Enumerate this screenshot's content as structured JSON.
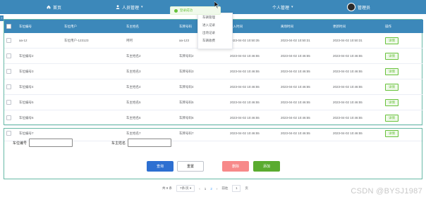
{
  "nav": {
    "home": "首页",
    "person_mgmt": "人员管理",
    "personal_mgmt": "个人管理",
    "username": "管理员",
    "menu_items": [
      "车辆管理",
      "进入记录",
      "出场记录",
      "车辆收费"
    ]
  },
  "toast": {
    "text": "登录成功"
  },
  "table": {
    "columns": [
      "车位编号",
      "车位用户",
      "车主姓名",
      "车牌号码",
      "进入时间",
      "离场时间",
      "更新时间",
      "操作"
    ],
    "rows": [
      [
        "aa-12",
        "车位用户-123123",
        "呵呵",
        "aa-123",
        "2023-04-02 10:50:35",
        "2023-04-02 10:50:31",
        "2023-04-02 10:50:31",
        "详情"
      ],
      [
        "车位编号2",
        "",
        "车主姓名2",
        "车牌号码2",
        "2023-04-02 10:46:55",
        "2023-04-02 10:46:55",
        "2023-04-02 10:46:55",
        "详情"
      ],
      [
        "车位编号3",
        "",
        "车主姓名3",
        "车牌号码3",
        "2023-04-02 10:46:55",
        "2023-04-02 10:46:55",
        "2023-04-02 10:46:55",
        "详情"
      ],
      [
        "车位编号4",
        "",
        "车主姓名4",
        "车牌号码4",
        "2023-04-02 10:46:55",
        "2023-04-02 10:46:55",
        "2023-04-02 10:46:55",
        "详情"
      ],
      [
        "车位编号5",
        "",
        "车主姓名5",
        "车牌号码5",
        "2023-04-02 10:46:55",
        "2023-04-02 10:46:55",
        "2023-04-02 10:46:55",
        "详情"
      ],
      [
        "车位编号6",
        "",
        "车主姓名6",
        "车牌号码6",
        "2023-04-02 10:46:55",
        "2023-04-02 10:46:55",
        "2023-04-02 10:46:55",
        "详情"
      ],
      [
        "车位编号7",
        "",
        "车主姓名7",
        "车牌号码7",
        "2023-04-02 10:46:55",
        "2023-04-02 10:46:55",
        "2023-04-02 10:46:55",
        "详情"
      ]
    ]
  },
  "search": {
    "label_spot": "车位编号",
    "label_owner": "车主姓名",
    "btn_query": "查询",
    "btn_reset": "重置",
    "btn_delete": "删除",
    "btn_add": "添加"
  },
  "pager": {
    "total": "共 9 条",
    "page_size": "7条/页",
    "pages": [
      "1",
      "2"
    ],
    "current": "2",
    "goto_label": "前往",
    "goto_value": "1",
    "page_unit": "页"
  },
  "watermark": "CSDN @BYSJ1987",
  "colors": {
    "nav_bg": "#3c88ba",
    "success": "#67c23a",
    "primary": "#2d6fd1",
    "danger": "#f78989",
    "border_accent": "#67b9a6"
  }
}
